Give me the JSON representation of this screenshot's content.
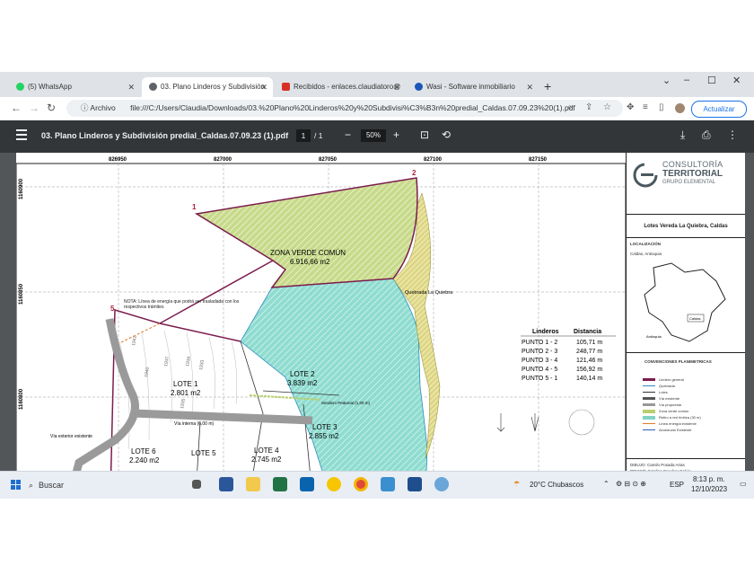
{
  "tabs": [
    {
      "label": "(5) WhatsApp",
      "favicon": "whatsapp-icon",
      "color": "#25d366"
    },
    {
      "label": "03. Plano Linderos y Subdivisión",
      "favicon": "globe-icon",
      "color": "#5f6368"
    },
    {
      "label": "Recibidos - enlaces.claudiatoro@",
      "favicon": "gmail-icon",
      "color": "#d93025"
    },
    {
      "label": "Wasi - Software inmobiliario",
      "favicon": "wasi-icon",
      "color": "#1a56b8"
    }
  ],
  "window_controls": {
    "minimize": "–",
    "maximize": "☐",
    "close": "✕",
    "dropdown": "⌄"
  },
  "address_bar": {
    "label": "Archivo",
    "url": "file:///C:/Users/Claudia/Downloads/03.%20Plano%20Linderos%20y%20Subdivisi%C3%B3n%20predial_Caldas.07.09.23%20(1).pdf",
    "update_button": "Actualizar"
  },
  "pdf_toolbar": {
    "title": "03. Plano Linderos y Subdivisión predial_Caldas.07.09.23 (1).pdf",
    "page_current": "1",
    "page_total": "/ 1",
    "zoom": "50%"
  },
  "map": {
    "x_coords": [
      "826950",
      "827000",
      "827050",
      "827100",
      "827150"
    ],
    "y_coords": [
      "1160900",
      "1160850",
      "1160800"
    ],
    "points": [
      "1",
      "2",
      "5"
    ],
    "zona_verde_title": "ZONA VERDE COMÚN",
    "zona_verde_area": "6.916,66 m2",
    "quebrada_label": "Quebrada La Quiebra",
    "nota": "NOTA: Línea de energía que podrá ser trasladada con los respectivos trámites",
    "lots": [
      {
        "name": "LOTE 1",
        "area": "2.801 m2"
      },
      {
        "name": "LOTE 2",
        "area": "3.839 m2"
      },
      {
        "name": "LOTE 3",
        "area": "2.855 m2"
      },
      {
        "name": "LOTE 4",
        "area": "2.745 m2"
      },
      {
        "name": "LOTE 5",
        "area": ""
      },
      {
        "name": "LOTE 6",
        "area": "2.240 m2"
      }
    ],
    "sendero_label": "Sendero Peatonal (1,00 m)",
    "via_interna": "Vía interna (6,00 m)",
    "via_exterior": "Vía exterior existente",
    "contours": [
      "1941",
      "1940",
      "1937",
      "1934",
      "1933",
      "1935"
    ],
    "linderos_table": {
      "headers": [
        "Linderos",
        "Distancia"
      ],
      "rows": [
        [
          "PUNTO 1 - 2",
          "105,71 m"
        ],
        [
          "PUNTO 2 - 3",
          "248,77 m"
        ],
        [
          "PUNTO 3 - 4",
          "121,46 m"
        ],
        [
          "PUNTO 4 - 5",
          "156,92 m"
        ],
        [
          "PUNTO 5 - 1",
          "140,14 m"
        ]
      ]
    }
  },
  "sidebar": {
    "logo_line1": "CONSULTORÍA",
    "logo_line2": "TERRITORIAL",
    "logo_line3": "GRUPO ELEMENTAL",
    "project_title": "Lotes Vereda La Quiebra, Caldas",
    "localizacion": "LOCALIZACIÓN",
    "localizacion_sub": "Caldas, Antioquia",
    "map_label_caldas": "Caldas",
    "map_label_antioquia": "Antioquia",
    "conventions_title": "CONVENCIONES PLANIMETRICAS",
    "legend": [
      {
        "label": "Lindero general",
        "color": "#7b1c4e"
      },
      {
        "label": "Quebrada",
        "color": "#2b8fbf"
      },
      {
        "label": "Lotes",
        "color": "#333333"
      },
      {
        "label": "Vía existente",
        "color": "#555555"
      },
      {
        "label": "Vía propuesta",
        "color": "#999999"
      },
      {
        "label": "Zona verde común",
        "color": "#b8cf6e"
      },
      {
        "label": "Retiro a red hídrica (30 m)",
        "color": "#7fd3c4"
      },
      {
        "label": "Línea energía existente",
        "color": "#e07a2a"
      },
      {
        "label": "Acueducto Existente",
        "color": "#2a5fbf"
      }
    ],
    "dibujo": "DIBUJO:  Camilo Posada Arias",
    "reviso": "REVISÓ:  Catalina Escobar Galvis"
  },
  "taskbar": {
    "search": "Buscar",
    "weather": "20°C  Chubascos",
    "language": "ESP",
    "time": "8:13 p. m.",
    "date": "12/10/2023"
  },
  "colors": {
    "border_purple": "#7b1c4e",
    "zona_verde": "#c7da8a",
    "retiro_cyan": "#8fdcd0",
    "pdf_bar": "#323639"
  }
}
